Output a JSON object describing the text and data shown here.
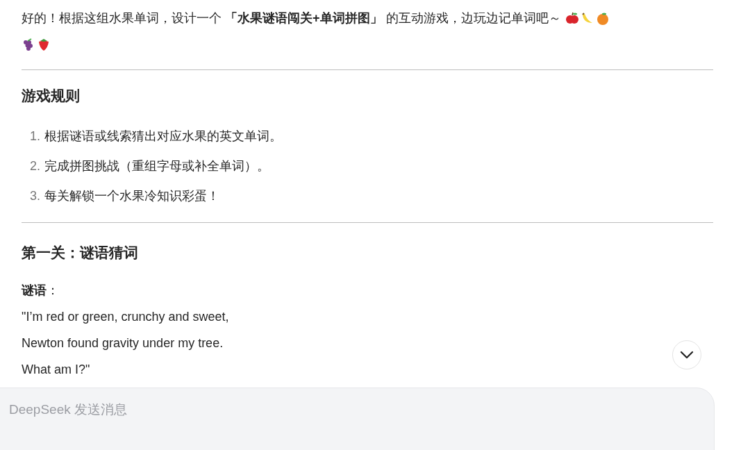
{
  "intro": "好的！根据这组水果单词，设计一个 **「水果谜语闯关+单词拼图」** 的互动游戏，边玩边记单词吧～",
  "intro_icons": [
    {
      "kind": "apple"
    },
    {
      "kind": "banana"
    },
    {
      "kind": "orange"
    },
    {
      "kind": "grapes"
    },
    {
      "kind": "strawberry"
    }
  ],
  "rules": {
    "title": "游戏规则",
    "items": [
      {
        "number": "1.",
        "text": "根据谜语或线索猜出对应水果的英文单词。"
      },
      {
        "number": "2.",
        "text": "完成拼图挑战（重组字母或补全单词）。"
      },
      {
        "number": "3.",
        "text": "每关解锁一个水果冷知识彩蛋！"
      }
    ]
  },
  "level_one": {
    "title": "第一关：谜语猜词",
    "riddle_label": "谜语",
    "riddle_colon": "：",
    "riddle_lines": [
      "\"I’m red or green, crunchy and sweet,",
      "Newton found gravity under my tree.",
      "What am I?\""
    ]
  },
  "composer": {
    "placeholder": "DeepSeek 发送消息"
  }
}
